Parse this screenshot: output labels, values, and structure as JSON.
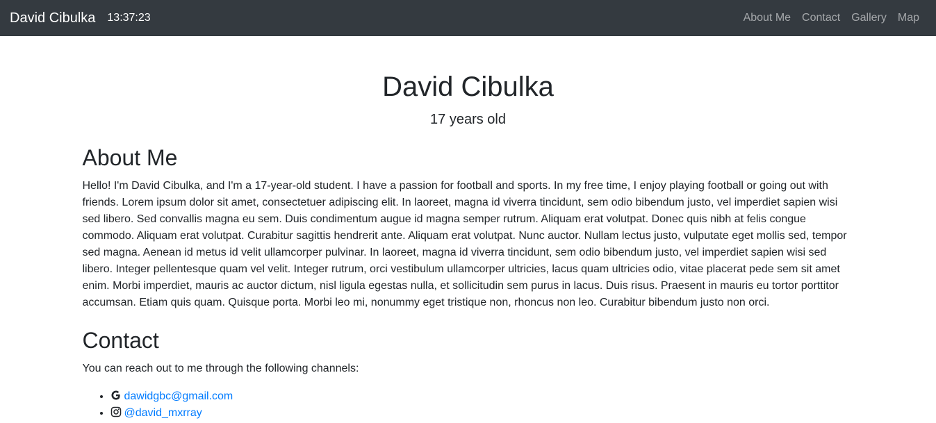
{
  "navbar": {
    "brand": "David Cibulka",
    "time": "13:37:23",
    "links": [
      "About Me",
      "Contact",
      "Gallery",
      "Map"
    ]
  },
  "hero": {
    "title": "David Cibulka",
    "age": "17 years old"
  },
  "about": {
    "heading": "About Me",
    "text": "Hello! I'm David Cibulka, and I'm a 17-year-old student. I have a passion for football and sports. In my free time, I enjoy playing football or going out with friends. Lorem ipsum dolor sit amet, consectetuer adipiscing elit. In laoreet, magna id viverra tincidunt, sem odio bibendum justo, vel imperdiet sapien wisi sed libero. Sed convallis magna eu sem. Duis condimentum augue id magna semper rutrum. Aliquam erat volutpat. Donec quis nibh at felis congue commodo. Aliquam erat volutpat. Curabitur sagittis hendrerit ante. Aliquam erat volutpat. Nunc auctor. Nullam lectus justo, vulputate eget mollis sed, tempor sed magna. Aenean id metus id velit ullamcorper pulvinar. In laoreet, magna id viverra tincidunt, sem odio bibendum justo, vel imperdiet sapien wisi sed libero. Integer pellentesque quam vel velit. Integer rutrum, orci vestibulum ullamcorper ultricies, lacus quam ultricies odio, vitae placerat pede sem sit amet enim. Morbi imperdiet, mauris ac auctor dictum, nisl ligula egestas nulla, et sollicitudin sem purus in lacus. Duis risus. Praesent in mauris eu tortor porttitor accumsan. Etiam quis quam. Quisque porta. Morbi leo mi, nonummy eget tristique non, rhoncus non leo. Curabitur bibendum justo non orci."
  },
  "contact": {
    "heading": "Contact",
    "intro": "You can reach out to me through the following channels:",
    "items": [
      {
        "icon": "google-icon",
        "label": "dawidgbc@gmail.com"
      },
      {
        "icon": "instagram-icon",
        "label": "@david_mxrray"
      }
    ]
  },
  "colors": {
    "navbar_bg": "#343a40",
    "link": "#007bff",
    "text": "#212529"
  }
}
